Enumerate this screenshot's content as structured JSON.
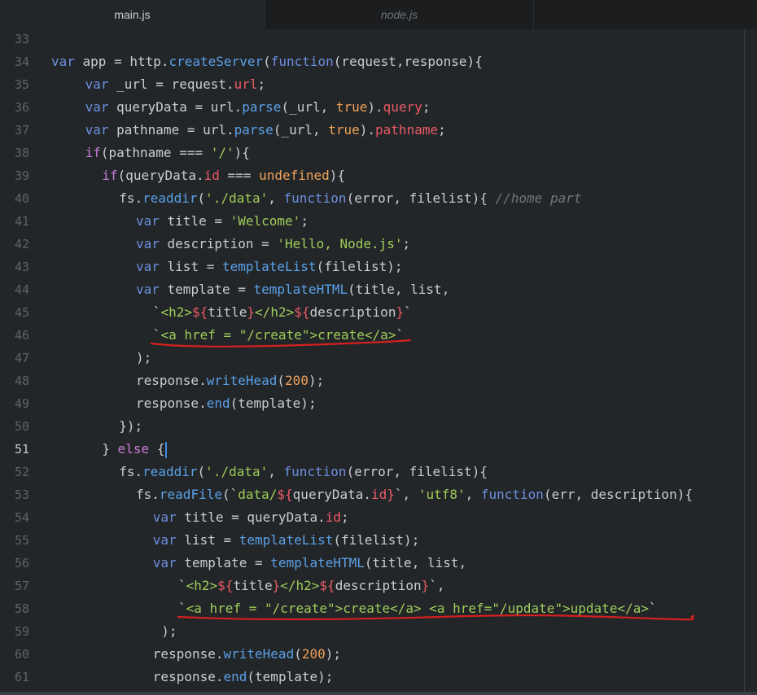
{
  "tabs": [
    {
      "label": "main.js",
      "active": true
    },
    {
      "label": "node.js",
      "active": false
    }
  ],
  "colors": {
    "keyword": "#6b8fdf",
    "function": "#5aa0e8",
    "string": "#9fcc5a",
    "property": "#ea5a66",
    "number": "#f0a25a",
    "purple": "#c67ad8",
    "comment": "#6f767c",
    "plain": "#c9cdd1",
    "annotation": "#d42020"
  },
  "lines": [
    {
      "n": "33",
      "indent": 0,
      "t": []
    },
    {
      "n": "34",
      "indent": 0,
      "t": [
        [
          "k",
          "var"
        ],
        [
          "p",
          " app = http."
        ],
        [
          "f",
          "createServer"
        ],
        [
          "p",
          "("
        ],
        [
          "k",
          "function"
        ],
        [
          "p",
          "(request,response){"
        ]
      ]
    },
    {
      "n": "35",
      "indent": 4,
      "t": [
        [
          "k",
          "var"
        ],
        [
          "p",
          " _url = request."
        ],
        [
          "r",
          "url"
        ],
        [
          "p",
          ";"
        ]
      ]
    },
    {
      "n": "36",
      "indent": 4,
      "t": [
        [
          "k",
          "var"
        ],
        [
          "p",
          " queryData = url."
        ],
        [
          "f",
          "parse"
        ],
        [
          "p",
          "(_url, "
        ],
        [
          "o",
          "true"
        ],
        [
          "p",
          ")."
        ],
        [
          "r",
          "query"
        ],
        [
          "p",
          ";"
        ]
      ]
    },
    {
      "n": "37",
      "indent": 4,
      "t": [
        [
          "k",
          "var"
        ],
        [
          "p",
          " pathname = url."
        ],
        [
          "f",
          "parse"
        ],
        [
          "p",
          "(_url, "
        ],
        [
          "o",
          "true"
        ],
        [
          "p",
          ")."
        ],
        [
          "r",
          "pathname"
        ],
        [
          "p",
          ";"
        ]
      ]
    },
    {
      "n": "38",
      "indent": 4,
      "t": [
        [
          "m",
          "if"
        ],
        [
          "p",
          "(pathname === "
        ],
        [
          "s",
          "'/'"
        ],
        [
          "p",
          "){"
        ]
      ]
    },
    {
      "n": "39",
      "indent": 6,
      "t": [
        [
          "m",
          "if"
        ],
        [
          "p",
          "(queryData."
        ],
        [
          "r",
          "id"
        ],
        [
          "p",
          " === "
        ],
        [
          "o",
          "undefined"
        ],
        [
          "p",
          "){"
        ]
      ]
    },
    {
      "n": "40",
      "indent": 8,
      "t": [
        [
          "p",
          "fs."
        ],
        [
          "f",
          "readdir"
        ],
        [
          "p",
          "("
        ],
        [
          "s",
          "'./data'"
        ],
        [
          "p",
          ", "
        ],
        [
          "k",
          "function"
        ],
        [
          "p",
          "(error, filelist){ "
        ],
        [
          "c",
          "//home part"
        ]
      ]
    },
    {
      "n": "41",
      "indent": 10,
      "t": [
        [
          "k",
          "var"
        ],
        [
          "p",
          " title = "
        ],
        [
          "s",
          "'Welcome'"
        ],
        [
          "p",
          ";"
        ]
      ]
    },
    {
      "n": "42",
      "indent": 10,
      "t": [
        [
          "k",
          "var"
        ],
        [
          "p",
          " description = "
        ],
        [
          "s",
          "'Hello, Node.js'"
        ],
        [
          "p",
          ";"
        ]
      ]
    },
    {
      "n": "43",
      "indent": 10,
      "t": [
        [
          "k",
          "var"
        ],
        [
          "p",
          " list = "
        ],
        [
          "f",
          "templateList"
        ],
        [
          "p",
          "(filelist);"
        ]
      ]
    },
    {
      "n": "44",
      "indent": 10,
      "t": [
        [
          "k",
          "var"
        ],
        [
          "p",
          " template = "
        ],
        [
          "f",
          "templateHTML"
        ],
        [
          "p",
          "(title, list,"
        ]
      ]
    },
    {
      "n": "45",
      "indent": 12,
      "t": [
        [
          "p",
          "`"
        ],
        [
          "s",
          "<h2>"
        ],
        [
          "r",
          "${"
        ],
        [
          "p",
          "title"
        ],
        [
          "r",
          "}"
        ],
        [
          "s",
          "</h2>"
        ],
        [
          "r",
          "${"
        ],
        [
          "p",
          "description"
        ],
        [
          "r",
          "}"
        ],
        [
          "p",
          "`"
        ]
      ]
    },
    {
      "n": "46",
      "indent": 12,
      "t": [
        [
          "p",
          "`"
        ],
        [
          "s",
          "<a href = \"/create\">create</a>"
        ],
        [
          "p",
          "`"
        ]
      ]
    },
    {
      "n": "47",
      "indent": 10,
      "t": [
        [
          "p",
          ");"
        ]
      ]
    },
    {
      "n": "48",
      "indent": 10,
      "t": [
        [
          "p",
          "response."
        ],
        [
          "f",
          "writeHead"
        ],
        [
          "p",
          "("
        ],
        [
          "o",
          "200"
        ],
        [
          "p",
          ");"
        ]
      ]
    },
    {
      "n": "49",
      "indent": 10,
      "t": [
        [
          "p",
          "response."
        ],
        [
          "f",
          "end"
        ],
        [
          "p",
          "(template);"
        ]
      ]
    },
    {
      "n": "50",
      "indent": 8,
      "t": [
        [
          "p",
          "});"
        ]
      ]
    },
    {
      "n": "51",
      "indent": 6,
      "t": [
        [
          "p",
          "} "
        ],
        [
          "m",
          "else"
        ],
        [
          "p",
          " {"
        ]
      ],
      "current": true
    },
    {
      "n": "52",
      "indent": 8,
      "t": [
        [
          "p",
          "fs."
        ],
        [
          "f",
          "readdir"
        ],
        [
          "p",
          "("
        ],
        [
          "s",
          "'./data'"
        ],
        [
          "p",
          ", "
        ],
        [
          "k",
          "function"
        ],
        [
          "p",
          "(error, filelist){"
        ]
      ]
    },
    {
      "n": "53",
      "indent": 10,
      "t": [
        [
          "p",
          "fs."
        ],
        [
          "f",
          "readFile"
        ],
        [
          "p",
          "(`"
        ],
        [
          "s",
          "data/"
        ],
        [
          "r",
          "${"
        ],
        [
          "p",
          "queryData."
        ],
        [
          "r",
          "id"
        ],
        [
          "r",
          "}"
        ],
        [
          "p",
          "`, "
        ],
        [
          "s",
          "'utf8'"
        ],
        [
          "p",
          ", "
        ],
        [
          "k",
          "function"
        ],
        [
          "p",
          "(err, description){"
        ]
      ]
    },
    {
      "n": "54",
      "indent": 12,
      "t": [
        [
          "k",
          "var"
        ],
        [
          "p",
          " title = queryData."
        ],
        [
          "r",
          "id"
        ],
        [
          "p",
          ";"
        ]
      ]
    },
    {
      "n": "55",
      "indent": 12,
      "t": [
        [
          "k",
          "var"
        ],
        [
          "p",
          " list = "
        ],
        [
          "f",
          "templateList"
        ],
        [
          "p",
          "(filelist);"
        ]
      ]
    },
    {
      "n": "56",
      "indent": 12,
      "t": [
        [
          "k",
          "var"
        ],
        [
          "p",
          " template = "
        ],
        [
          "f",
          "templateHTML"
        ],
        [
          "p",
          "(title, list,"
        ]
      ]
    },
    {
      "n": "57",
      "indent": 15,
      "t": [
        [
          "p",
          "`"
        ],
        [
          "s",
          "<h2>"
        ],
        [
          "r",
          "${"
        ],
        [
          "p",
          "title"
        ],
        [
          "r",
          "}"
        ],
        [
          "s",
          "</h2>"
        ],
        [
          "r",
          "${"
        ],
        [
          "p",
          "description"
        ],
        [
          "r",
          "}"
        ],
        [
          "p",
          "`,"
        ]
      ]
    },
    {
      "n": "58",
      "indent": 15,
      "t": [
        [
          "p",
          "`"
        ],
        [
          "s",
          "<a href = \"/create\">create</a> <a href=\"/update\">update</a>"
        ],
        [
          "p",
          "`"
        ]
      ]
    },
    {
      "n": "59",
      "indent": 13,
      "t": [
        [
          "p",
          ");"
        ]
      ]
    },
    {
      "n": "60",
      "indent": 12,
      "t": [
        [
          "p",
          "response."
        ],
        [
          "f",
          "writeHead"
        ],
        [
          "p",
          "("
        ],
        [
          "o",
          "200"
        ],
        [
          "p",
          ");"
        ]
      ]
    },
    {
      "n": "61",
      "indent": 12,
      "t": [
        [
          "p",
          "response."
        ],
        [
          "f",
          "end"
        ],
        [
          "p",
          "(template);"
        ]
      ]
    }
  ],
  "annotations": [
    {
      "line": "46",
      "description": "red hand-drawn underline"
    },
    {
      "line": "58",
      "description": "red hand-drawn underline"
    }
  ]
}
